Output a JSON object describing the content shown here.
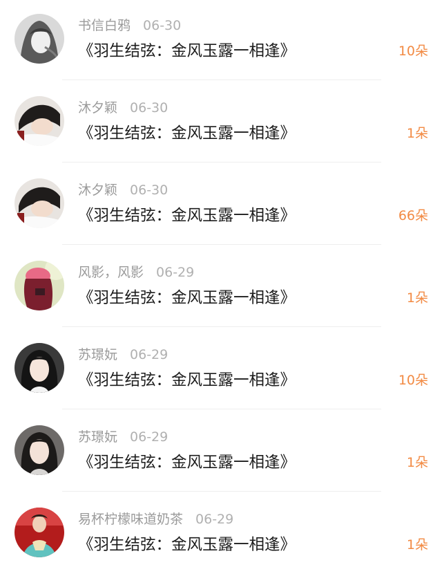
{
  "colors": {
    "count_accent": "#f28a43",
    "meta_gray": "#9a9a9a",
    "title_text": "#1c1c1c",
    "divider": "#eeeeee"
  },
  "items": [
    {
      "user": "书信白鸦",
      "date": "06-30",
      "title": "《羽生结弦：金风玉露一相逢》",
      "count": "10朵",
      "avatar_icon": "user-avatar-icon"
    },
    {
      "user": "沐夕颖",
      "date": "06-30",
      "title": "《羽生结弦：金风玉露一相逢》",
      "count": "1朵",
      "avatar_icon": "user-avatar-icon"
    },
    {
      "user": "沐夕颖",
      "date": "06-30",
      "title": "《羽生结弦：金风玉露一相逢》",
      "count": "66朵",
      "avatar_icon": "user-avatar-icon"
    },
    {
      "user": "风影，风影",
      "date": "06-29",
      "title": "《羽生结弦：金风玉露一相逢》",
      "count": "1朵",
      "avatar_icon": "user-avatar-icon"
    },
    {
      "user": "苏璟妧",
      "date": "06-29",
      "title": "《羽生结弦：金风玉露一相逢》",
      "count": "10朵",
      "avatar_icon": "user-avatar-icon"
    },
    {
      "user": "苏璟妧",
      "date": "06-29",
      "title": "《羽生结弦：金风玉露一相逢》",
      "count": "1朵",
      "avatar_icon": "user-avatar-icon"
    },
    {
      "user": "易杯柠檬味道奶茶",
      "date": "06-29",
      "title": "《羽生结弦：金风玉露一相逢》",
      "count": "1朵",
      "avatar_icon": "user-avatar-icon"
    }
  ]
}
